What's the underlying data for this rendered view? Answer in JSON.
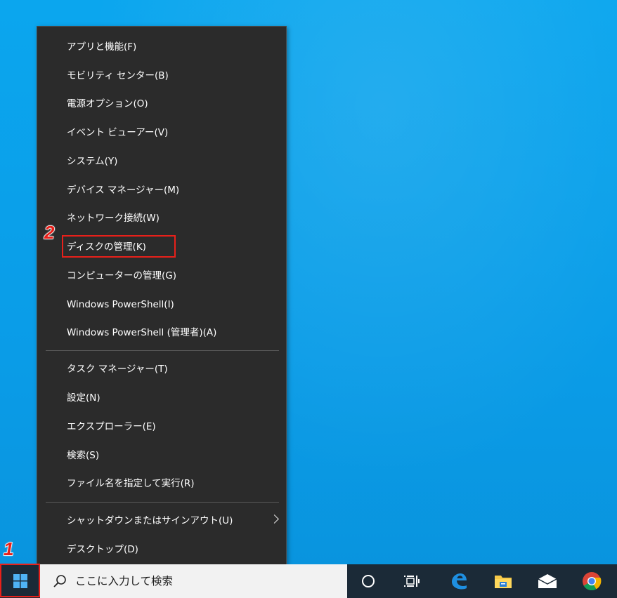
{
  "annotations": {
    "step1": "1",
    "step2": "2"
  },
  "menu": {
    "items_group1": [
      "アプリと機能(F)",
      "モビリティ センター(B)",
      "電源オプション(O)",
      "イベント ビューアー(V)",
      "システム(Y)",
      "デバイス マネージャー(M)",
      "ネットワーク接続(W)",
      "ディスクの管理(K)",
      "コンピューターの管理(G)",
      "Windows PowerShell(I)",
      "Windows PowerShell (管理者)(A)"
    ],
    "items_group2": [
      "タスク マネージャー(T)",
      "設定(N)",
      "エクスプローラー(E)",
      "検索(S)",
      "ファイル名を指定して実行(R)"
    ],
    "items_group3": [
      "シャットダウンまたはサインアウト(U)",
      "デスクトップ(D)"
    ],
    "highlighted_item": "ディスクの管理(K)"
  },
  "taskbar": {
    "search_placeholder": "ここに入力して検索",
    "icons": [
      "windows-start-icon",
      "search-icon",
      "cortana-icon",
      "task-view-icon",
      "edge-icon",
      "file-explorer-icon",
      "mail-icon",
      "chrome-icon"
    ]
  },
  "colors": {
    "desktop": "#0a9ee8",
    "menu_bg": "#2b2b2b",
    "taskbar": "#1b2a37",
    "annotation_red": "#e8201a"
  }
}
